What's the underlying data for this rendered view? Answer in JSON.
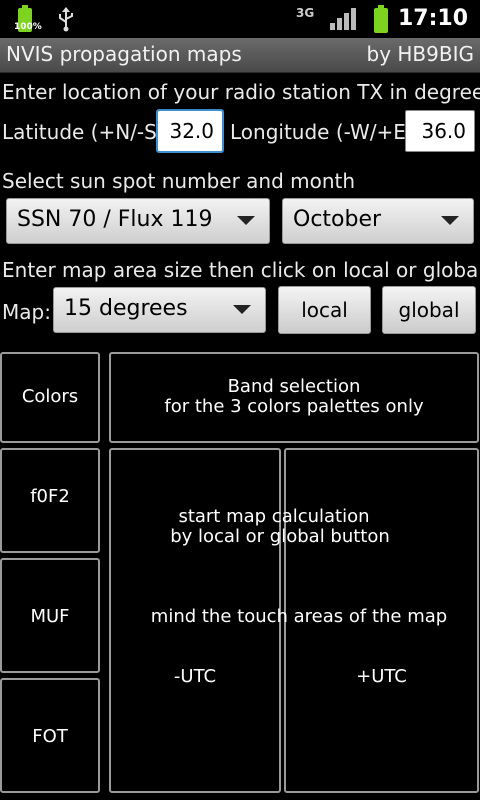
{
  "status_bar": {
    "battery_pct": "100%",
    "usb_icon": "usb-icon",
    "network": "3G",
    "time": "17:10"
  },
  "app": {
    "title": "NVIS propagation maps",
    "author": "by HB9BIG"
  },
  "location": {
    "prompt": "Enter location of your radio station TX in degrees",
    "latitude_label": "Latitude (+N/-S):",
    "latitude_value": "32.0",
    "longitude_label": "Longitude (-W/+E):",
    "longitude_value": "36.0"
  },
  "sun": {
    "prompt": "Select sun spot number and month",
    "ssn_selected": "SSN 70 / Flux 119",
    "month_selected": "October"
  },
  "map": {
    "prompt": "Enter map area size then click on local or global",
    "label": "Map:",
    "size_selected": "15 degrees",
    "local_button": "local",
    "global_button": "global"
  },
  "panels": {
    "colors": "Colors",
    "band_line1": "Band selection",
    "band_line2": "for the 3 colors palettes only",
    "f0f2": "f0F2",
    "muf": "MUF",
    "fot": "FOT",
    "calc_line1": "start map calculation",
    "calc_line2": "by local or global button",
    "touch_hint": "mind the touch areas of the map",
    "minus_utc": "-UTC",
    "plus_utc": "+UTC"
  },
  "colors": {
    "accent_focus": "#3d8ecf",
    "battery": "#7ed321",
    "background": "#000000"
  }
}
